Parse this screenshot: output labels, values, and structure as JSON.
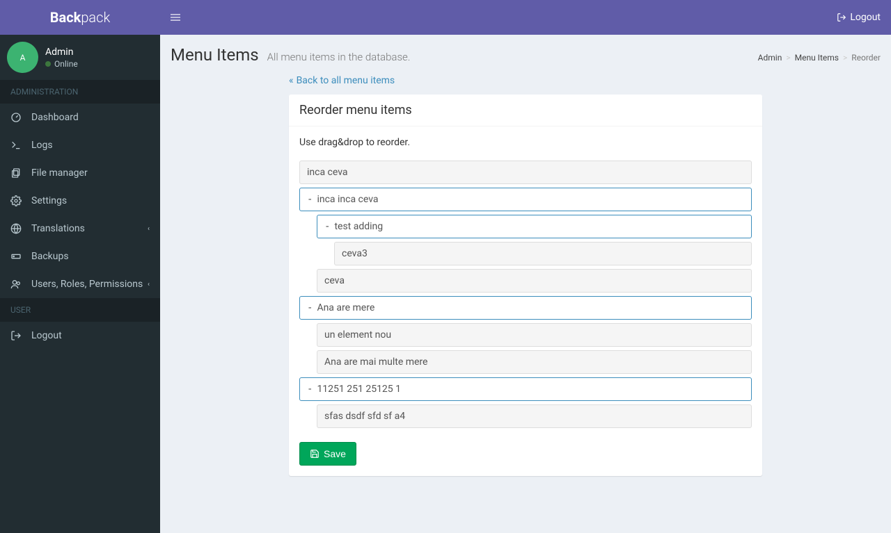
{
  "brand": {
    "bold": "Back",
    "light": "pack"
  },
  "user": {
    "name": "Admin",
    "initial": "A",
    "status": "Online"
  },
  "topnav": {
    "logout": "Logout"
  },
  "sidebar": {
    "section_admin": "ADMINISTRATION",
    "section_user": "USER",
    "items": [
      {
        "label": "Dashboard"
      },
      {
        "label": "Logs"
      },
      {
        "label": "File manager"
      },
      {
        "label": "Settings"
      },
      {
        "label": "Translations"
      },
      {
        "label": "Backups"
      },
      {
        "label": "Users, Roles, Permissions"
      }
    ],
    "logout": "Logout"
  },
  "page": {
    "title": "Menu Items",
    "subtitle": "All menu items in the database.",
    "back_link": "Back to all menu items",
    "box_title": "Reorder menu items",
    "hint": "Use drag&drop to reorder.",
    "save": "Save"
  },
  "breadcrumb": {
    "admin": "Admin",
    "menu_items": "Menu Items",
    "reorder": "Reorder"
  },
  "tree": {
    "n0": "inca ceva",
    "n1": "inca inca ceva",
    "n1_0": "test adding",
    "n1_0_0": "ceva3",
    "n1_1": "ceva",
    "n2": "Ana are mere",
    "n2_0": "un element nou",
    "n2_1": "Ana are mai multe mere",
    "n3": "11251 251 25125 1",
    "n3_0": "sfas dsdf sfd sf a4"
  },
  "colors": {
    "primary": "#605ca8",
    "sidebar": "#222d32",
    "link": "#3c8dbc",
    "success": "#00a65a"
  }
}
